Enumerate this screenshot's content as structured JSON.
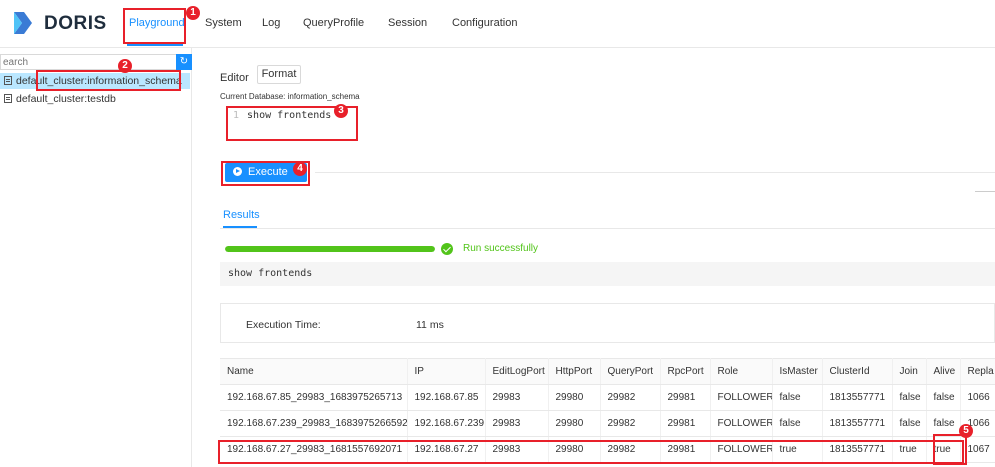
{
  "header": {
    "brand": "DORIS",
    "tabs": [
      {
        "label": "Playground",
        "active": true
      },
      {
        "label": "System"
      },
      {
        "label": "Log"
      },
      {
        "label": "QueryProfile"
      },
      {
        "label": "Session"
      },
      {
        "label": "Configuration"
      }
    ]
  },
  "sidebar": {
    "search_placeholder": "earch",
    "refresh_icon": "refresh-icon",
    "items": [
      {
        "label": "default_cluster:information_schema",
        "selected": true
      },
      {
        "label": "default_cluster:testdb",
        "selected": false
      }
    ]
  },
  "editor": {
    "label": "Editor",
    "format_label": "Format",
    "current_db": "Current Database: information_schema",
    "line_number": "1",
    "code": "show frontends",
    "execute_label": "Execute"
  },
  "results": {
    "tab_label": "Results",
    "progress_fraction": 1.0,
    "status": "Run successfully",
    "sql": "show frontends",
    "exec_time_label": "Execution Time:",
    "exec_time_value": "11 ms",
    "columns": [
      "Name",
      "IP",
      "EditLogPort",
      "HttpPort",
      "QueryPort",
      "RpcPort",
      "Role",
      "IsMaster",
      "ClusterId",
      "Join",
      "Alive",
      "Repla"
    ],
    "rows": [
      [
        "192.168.67.85_29983_1683975265713",
        "192.168.67.85",
        "29983",
        "29980",
        "29982",
        "29981",
        "FOLLOWER",
        "false",
        "1813557771",
        "false",
        "false",
        "1066"
      ],
      [
        "192.168.67.239_29983_1683975266592",
        "192.168.67.239",
        "29983",
        "29980",
        "29982",
        "29981",
        "FOLLOWER",
        "false",
        "1813557771",
        "false",
        "false",
        "1066"
      ],
      [
        "192.168.67.27_29983_1681557692071",
        "192.168.67.27",
        "29983",
        "29980",
        "29982",
        "29981",
        "FOLLOWER",
        "true",
        "1813557771",
        "true",
        "true",
        "1067"
      ]
    ]
  },
  "annotations": [
    "1",
    "2",
    "3",
    "4",
    "5"
  ],
  "colors": {
    "accent": "#1890ff",
    "success": "#52c41a",
    "annotation": "#e8202a"
  }
}
